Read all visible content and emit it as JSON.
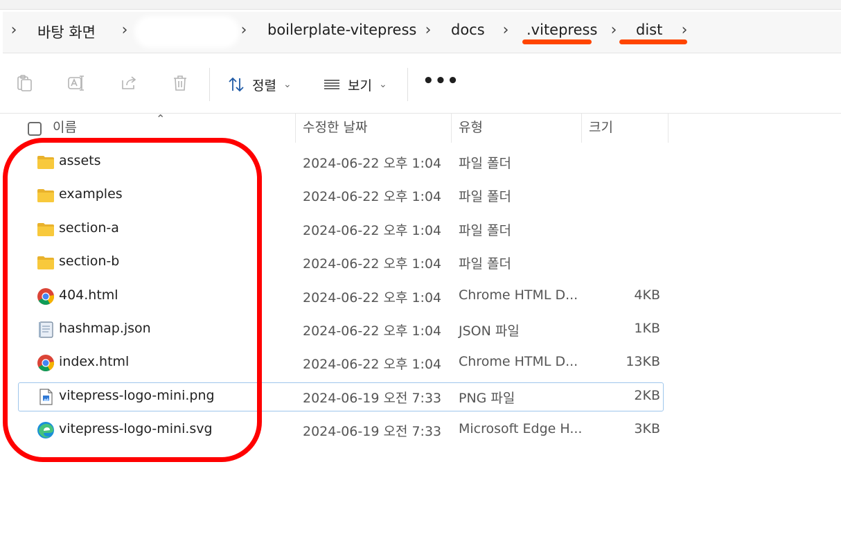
{
  "breadcrumb": {
    "items": [
      "바탕 화면",
      "",
      "boilerplate-vitepress",
      "docs",
      ".vitepress",
      "dist"
    ]
  },
  "toolbar": {
    "sort_label": "정렬",
    "view_label": "보기",
    "more_label": "•••"
  },
  "columns": {
    "name": "이름",
    "date": "수정한 날짜",
    "type": "유형",
    "size": "크기"
  },
  "files": [
    {
      "name": "assets",
      "date": "2024-06-22 오후 1:04",
      "type": "파일 폴더",
      "size": "",
      "icon": "folder-icon"
    },
    {
      "name": "examples",
      "date": "2024-06-22 오후 1:04",
      "type": "파일 폴더",
      "size": "",
      "icon": "folder-icon"
    },
    {
      "name": "section-a",
      "date": "2024-06-22 오후 1:04",
      "type": "파일 폴더",
      "size": "",
      "icon": "folder-icon"
    },
    {
      "name": "section-b",
      "date": "2024-06-22 오후 1:04",
      "type": "파일 폴더",
      "size": "",
      "icon": "folder-icon"
    },
    {
      "name": "404.html",
      "date": "2024-06-22 오후 1:04",
      "type": "Chrome HTML D...",
      "size": "4KB",
      "icon": "chrome-icon"
    },
    {
      "name": "hashmap.json",
      "date": "2024-06-22 오후 1:04",
      "type": "JSON 파일",
      "size": "1KB",
      "icon": "json-file-icon"
    },
    {
      "name": "index.html",
      "date": "2024-06-22 오후 1:04",
      "type": "Chrome HTML D...",
      "size": "13KB",
      "icon": "chrome-icon"
    },
    {
      "name": "vitepress-logo-mini.png",
      "date": "2024-06-19 오전 7:33",
      "type": "PNG 파일",
      "size": "2KB",
      "icon": "image-file-icon"
    },
    {
      "name": "vitepress-logo-mini.svg",
      "date": "2024-06-19 오전 7:33",
      "type": "Microsoft Edge H...",
      "size": "3KB",
      "icon": "edge-icon"
    }
  ],
  "colors": {
    "annotation_red": "#ff0000",
    "underline_orange": "#ff4500",
    "folder_yellow": "#f8c93c",
    "selection_border": "#9ec6ec"
  }
}
